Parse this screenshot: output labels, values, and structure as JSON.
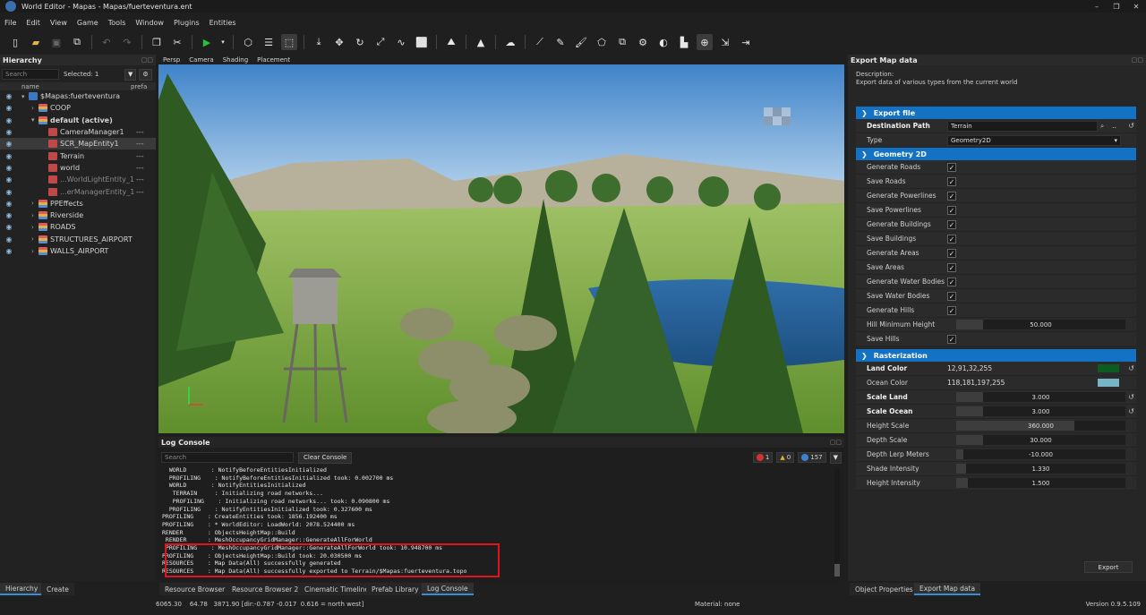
{
  "window": {
    "title": "World Editor - Mapas - Mapas/fuerteventura.ent",
    "min": "–",
    "restore": "❐",
    "close": "✕"
  },
  "menu": [
    "File",
    "Edit",
    "View",
    "Game",
    "Tools",
    "Window",
    "Plugins",
    "Entities"
  ],
  "toolbar": {
    "icons": [
      "new-file-icon",
      "open-folder-icon",
      "save-icon",
      "export-icon",
      "undo-icon",
      "redo-icon",
      "copy-icon",
      "cut-icon",
      "play-icon",
      "cube-icon",
      "layers-icon",
      "select-box-icon",
      "drop-to-ground-icon",
      "move-icon",
      "rotate-icon",
      "scale-icon",
      "path-icon",
      "rectangle-select-icon",
      "terrain-icon",
      "vertex-icon",
      "weather-icon",
      "road-icon",
      "prefab-brush-icon",
      "paint-icon",
      "polygon-icon",
      "copies-icon",
      "gears-icon",
      "fire-icon",
      "cityscape-icon",
      "globe-icon",
      "import-icon",
      "export-out-icon"
    ]
  },
  "hierarchy": {
    "title": "Hierarchy",
    "search_placeholder": "Search",
    "selected": "Selected: 1",
    "col_name": "name",
    "col_prefab": "prefa",
    "items": [
      {
        "label": "$Mapas:fuerteventura",
        "depth": 0,
        "icon": "globe",
        "arrow": "▾",
        "dash": ""
      },
      {
        "label": "COOP",
        "depth": 1,
        "icon": "stack",
        "arrow": "›",
        "dash": ""
      },
      {
        "label": "default (active)",
        "depth": 1,
        "icon": "stack",
        "arrow": "▾",
        "dash": "",
        "bold": true
      },
      {
        "label": "CameraManager1",
        "depth": 2,
        "icon": "ent",
        "arrow": "",
        "dash": "---"
      },
      {
        "label": "SCR_MapEntity1",
        "depth": 2,
        "icon": "ent",
        "arrow": "",
        "dash": "---",
        "selected": true
      },
      {
        "label": "Terrain",
        "depth": 2,
        "icon": "ent",
        "arrow": "",
        "dash": "---"
      },
      {
        "label": "world",
        "depth": 2,
        "icon": "ent",
        "arrow": "",
        "dash": "---"
      },
      {
        "label": "...WorldLightEntity_1",
        "depth": 2,
        "icon": "ent",
        "arrow": "",
        "dash": "---",
        "dim": true
      },
      {
        "label": "...erManagerEntity_1",
        "depth": 2,
        "icon": "ent",
        "arrow": "",
        "dash": "---",
        "dim": true
      },
      {
        "label": "PPEffects",
        "depth": 1,
        "icon": "stack",
        "arrow": "›",
        "dash": ""
      },
      {
        "label": "Riverside",
        "depth": 1,
        "icon": "stack",
        "arrow": "›",
        "dash": ""
      },
      {
        "label": "ROADS",
        "depth": 1,
        "icon": "stack",
        "arrow": "›",
        "dash": ""
      },
      {
        "label": "STRUCTURES_AIRPORT",
        "depth": 1,
        "icon": "stack",
        "arrow": "›",
        "dash": ""
      },
      {
        "label": "WALLS_AIRPORT",
        "depth": 1,
        "icon": "stack",
        "arrow": "›",
        "dash": ""
      }
    ]
  },
  "viewport": {
    "tabs": [
      "Persp",
      "Camera",
      "Shading",
      "Placement"
    ]
  },
  "console": {
    "title": "Log Console",
    "search_placeholder": "Search",
    "clear": "Clear Console",
    "errors": "1",
    "warnings": "0",
    "infos": "157",
    "lines": [
      "  WORLD       : NotifyBeforeEntitiesInitialized",
      "  PROFILING    : NotifyBeforeEntitiesInitialized took: 0.002700 ms",
      "  WORLD       : NotifyEntitiesInitialized",
      "   TERRAIN     : Initializing road networks...",
      "   PROFILING    : Initializing road networks... took: 0.090800 ms",
      "  PROFILING    : NotifyEntitiesInitialized took: 0.327600 ms",
      "PROFILING    : CreateEntities took: 1856.192400 ms",
      "PROFILING    : * WorldEditor: LoadWorld: 2078.524400 ms",
      "RENDER       : ObjectsHeightMap::Build",
      " RENDER      : MeshOccupancyGridManager::GenerateAllForWorld",
      " PROFILING    : MeshOccupancyGridManager::GenerateAllForWorld took: 10.948700 ms",
      "PROFILING    : ObjectsHeightMap::Build took: 20.030500 ms",
      "RESOURCES    : Map Data(All) successfully generated",
      "RESOURCES    : Map Data(All) successfully exported to Terrain/$Mapas:fuerteventura.topo"
    ]
  },
  "export": {
    "title": "Export Map data",
    "desc_label": "Description:",
    "desc": "Export data of various types from the current world",
    "sections": {
      "file": "Export file",
      "geo": "Geometry 2D",
      "rast": "Rasterization"
    },
    "dest_label": "Destination Path",
    "dest_value": "Terrain",
    "type_label": "Type",
    "type_value": "Geometry2D",
    "geo_rows": [
      {
        "label": "Generate Roads",
        "checked": true
      },
      {
        "label": "Save Roads",
        "checked": true
      },
      {
        "label": "Generate Powerlines",
        "checked": true
      },
      {
        "label": "Save Powerlines",
        "checked": true
      },
      {
        "label": "Generate Buildings",
        "checked": true
      },
      {
        "label": "Save Buildings",
        "checked": true
      },
      {
        "label": "Generate Areas",
        "checked": true
      },
      {
        "label": "Save Areas",
        "checked": true
      },
      {
        "label": "Generate Water Bodies",
        "checked": true
      },
      {
        "label": "Save Water Bodies",
        "checked": true
      },
      {
        "label": "Generate Hills",
        "checked": true
      }
    ],
    "hill_label": "Hill Minimum Height",
    "hill_value": "50.000",
    "save_hills": "Save Hills",
    "land_label": "Land Color",
    "land_value": "12,91,32,255",
    "land_hex": "#0c5b20",
    "ocean_label": "Ocean Color",
    "ocean_value": "118,181,197,255",
    "ocean_hex": "#76b5c5",
    "rast_rows": [
      {
        "label": "Scale Land",
        "value": "3.000",
        "fill": 0.16,
        "bold": true,
        "reset": true
      },
      {
        "label": "Scale Ocean",
        "value": "3.000",
        "fill": 0.16,
        "bold": true,
        "reset": true
      },
      {
        "label": "Height Scale",
        "value": "360.000",
        "fill": 0.7,
        "bold": false,
        "reset": false
      },
      {
        "label": "Depth Scale",
        "value": "30.000",
        "fill": 0.16,
        "bold": false,
        "reset": false
      },
      {
        "label": "Depth Lerp Meters",
        "value": "-10.000",
        "fill": 0.04,
        "bold": false,
        "reset": false
      },
      {
        "label": "Shade Intensity",
        "value": "1.330",
        "fill": 0.06,
        "bold": false,
        "reset": false
      },
      {
        "label": "Height Intensity",
        "value": "1.500",
        "fill": 0.07,
        "bold": false,
        "reset": false
      }
    ],
    "export_btn": "Export"
  },
  "bottom": {
    "left_tabs": [
      "Hierarchy",
      "Create"
    ],
    "center_tabs": [
      "Resource Browser",
      "Resource Browser 2",
      "Cinematic Timeline",
      "Prefab Library",
      "Log Console"
    ],
    "right_tabs": [
      "Object Properties",
      "Export Map data"
    ]
  },
  "status": {
    "coords": "6065.30    64.78   3871.90 [dir:-0.787 -0.017  0.616 = north west]",
    "material": "Material: none",
    "version": "Version 0.9.5.109"
  }
}
